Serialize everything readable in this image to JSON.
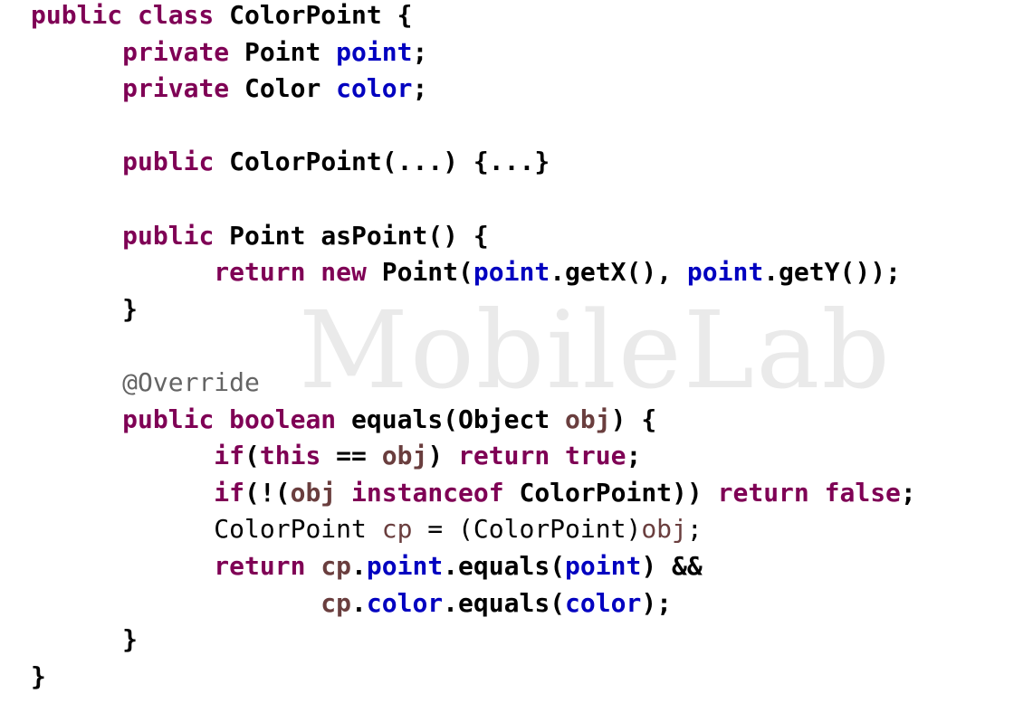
{
  "colors": {
    "keyword": "#7f0055",
    "field": "#0000c0",
    "local": "#6a3e3e",
    "annotation": "#646464",
    "plain": "#000000"
  },
  "watermark": "MobileLab",
  "code_lines": [
    [
      {
        "t": "public class ",
        "k": "keyword"
      },
      {
        "t": "ColorPoint {",
        "k": "plain"
      }
    ],
    [
      {
        "t": "      "
      },
      {
        "t": "private ",
        "k": "keyword"
      },
      {
        "t": "Point ",
        "k": "plain"
      },
      {
        "t": "point",
        "k": "field"
      },
      {
        "t": ";",
        "k": "plain"
      }
    ],
    [
      {
        "t": "      "
      },
      {
        "t": "private ",
        "k": "keyword"
      },
      {
        "t": "Color ",
        "k": "plain"
      },
      {
        "t": "color",
        "k": "field"
      },
      {
        "t": ";",
        "k": "plain"
      }
    ],
    [],
    [
      {
        "t": "      "
      },
      {
        "t": "public ",
        "k": "keyword"
      },
      {
        "t": "ColorPoint(...) {...}",
        "k": "plain"
      }
    ],
    [],
    [
      {
        "t": "      "
      },
      {
        "t": "public ",
        "k": "keyword"
      },
      {
        "t": "Point asPoint() {",
        "k": "plain"
      }
    ],
    [
      {
        "t": "            "
      },
      {
        "t": "return new ",
        "k": "keyword"
      },
      {
        "t": "Point(",
        "k": "plain"
      },
      {
        "t": "point",
        "k": "field"
      },
      {
        "t": ".getX(), ",
        "k": "plain"
      },
      {
        "t": "point",
        "k": "field"
      },
      {
        "t": ".getY());",
        "k": "plain"
      }
    ],
    [
      {
        "t": "      "
      },
      {
        "t": "}",
        "k": "plain"
      }
    ],
    [],
    [
      {
        "t": "      "
      },
      {
        "t": "@Override",
        "k": "annotation",
        "light": true
      }
    ],
    [
      {
        "t": "      "
      },
      {
        "t": "public boolean ",
        "k": "keyword"
      },
      {
        "t": "equals(Object ",
        "k": "plain"
      },
      {
        "t": "obj",
        "k": "local"
      },
      {
        "t": ") {",
        "k": "plain"
      }
    ],
    [
      {
        "t": "            "
      },
      {
        "t": "if",
        "k": "keyword"
      },
      {
        "t": "(",
        "k": "plain"
      },
      {
        "t": "this",
        "k": "keyword"
      },
      {
        "t": " == ",
        "k": "plain"
      },
      {
        "t": "obj",
        "k": "local"
      },
      {
        "t": ") ",
        "k": "plain"
      },
      {
        "t": "return true",
        "k": "keyword"
      },
      {
        "t": ";",
        "k": "plain"
      }
    ],
    [
      {
        "t": "            "
      },
      {
        "t": "if",
        "k": "keyword"
      },
      {
        "t": "(!(",
        "k": "plain"
      },
      {
        "t": "obj",
        "k": "local"
      },
      {
        "t": " ",
        "k": "plain"
      },
      {
        "t": "instanceof",
        "k": "keyword"
      },
      {
        "t": " ColorPoint)) ",
        "k": "plain"
      },
      {
        "t": "return false",
        "k": "keyword"
      },
      {
        "t": ";",
        "k": "plain"
      }
    ],
    [
      {
        "t": "            "
      },
      {
        "t": "ColorPoint ",
        "k": "plain",
        "light": true
      },
      {
        "t": "cp",
        "k": "local",
        "light": true
      },
      {
        "t": " = (ColorPoint)",
        "k": "plain",
        "light": true
      },
      {
        "t": "obj",
        "k": "local",
        "light": true
      },
      {
        "t": ";",
        "k": "plain",
        "light": true
      }
    ],
    [
      {
        "t": "            "
      },
      {
        "t": "return ",
        "k": "keyword"
      },
      {
        "t": "cp",
        "k": "local"
      },
      {
        "t": ".",
        "k": "plain"
      },
      {
        "t": "point",
        "k": "field"
      },
      {
        "t": ".equals(",
        "k": "plain"
      },
      {
        "t": "point",
        "k": "field"
      },
      {
        "t": ") &&",
        "k": "plain"
      }
    ],
    [
      {
        "t": "                   "
      },
      {
        "t": "cp",
        "k": "local"
      },
      {
        "t": ".",
        "k": "plain"
      },
      {
        "t": "color",
        "k": "field"
      },
      {
        "t": ".equals(",
        "k": "plain"
      },
      {
        "t": "color",
        "k": "field"
      },
      {
        "t": ");",
        "k": "plain"
      }
    ],
    [
      {
        "t": "      "
      },
      {
        "t": "}",
        "k": "plain"
      }
    ],
    [
      {
        "t": "}",
        "k": "plain"
      }
    ]
  ]
}
